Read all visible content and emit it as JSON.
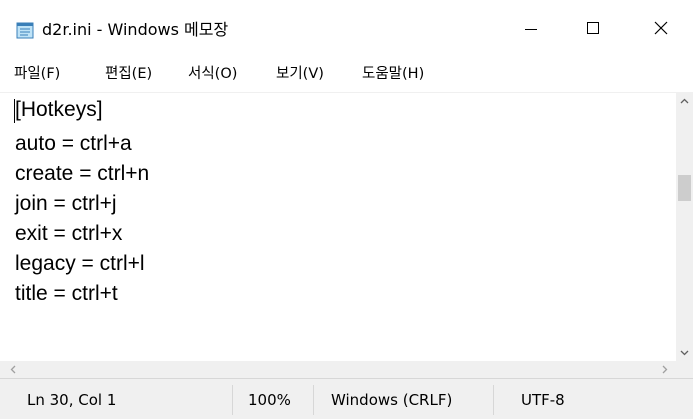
{
  "window": {
    "title": "d2r.ini - Windows 메모장",
    "icon": "notepad-icon"
  },
  "caption_buttons": {
    "minimize": "minimize-icon",
    "maximize": "maximize-icon",
    "close_glyph": "✕"
  },
  "menu": {
    "items": [
      {
        "label": "파일(F)"
      },
      {
        "label": "편집(E)"
      },
      {
        "label": "서식(O)"
      },
      {
        "label": "보기(V)"
      },
      {
        "label": "도움말(H)"
      }
    ]
  },
  "editor": {
    "lines": [
      "[Hotkeys]",
      "auto = ctrl+a",
      "create = ctrl+n",
      "join = ctrl+j",
      "exit = ctrl+x",
      "legacy = ctrl+l",
      "title = ctrl+t"
    ]
  },
  "status": {
    "position": "Ln 30, Col 1",
    "zoom": "100%",
    "line_ending": "Windows (CRLF)",
    "encoding": "UTF-8"
  }
}
